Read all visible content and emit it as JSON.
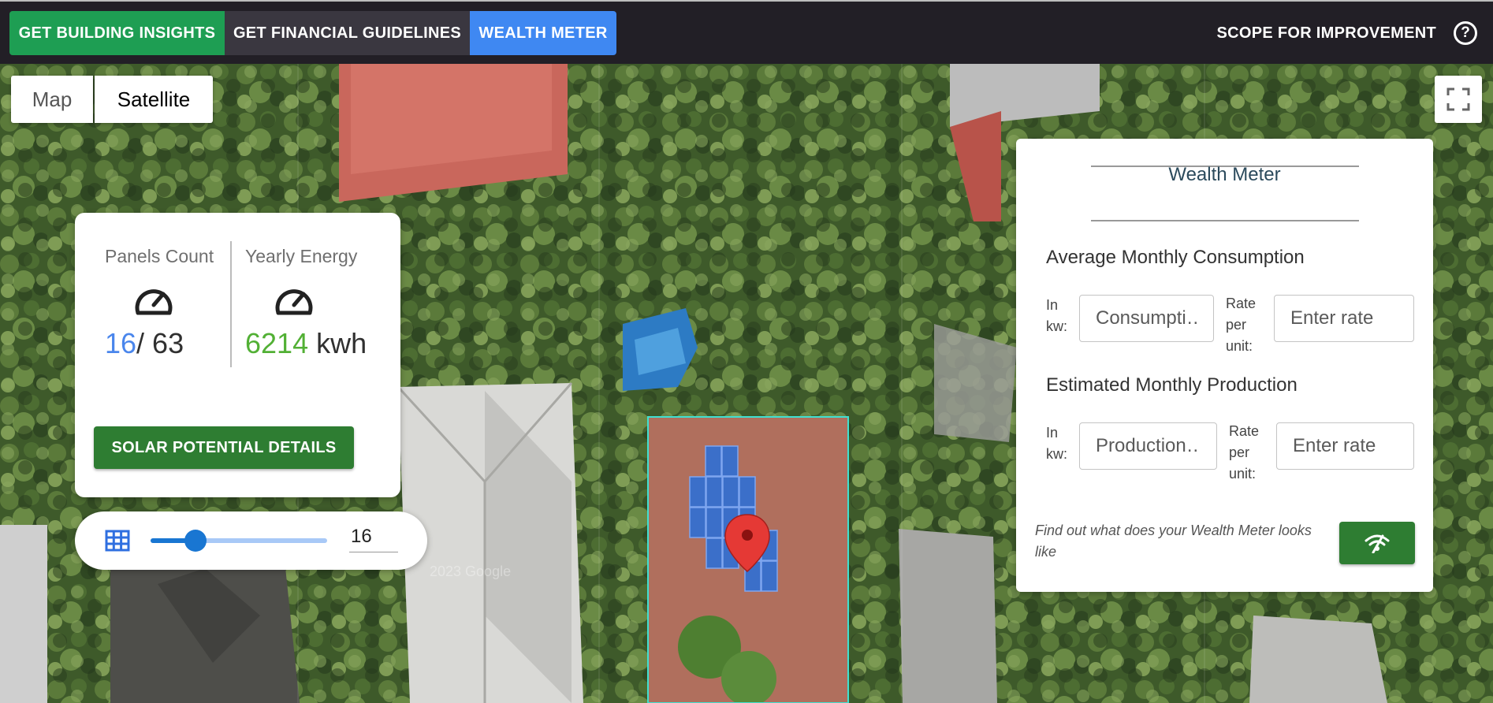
{
  "header": {
    "tabs": [
      {
        "label": "GET BUILDING INSIGHTS",
        "color": "#1e9e53"
      },
      {
        "label": "GET FINANCIAL GUIDELINES",
        "color": "#3a3740"
      },
      {
        "label": "WEALTH METER",
        "color": "#3f88f2",
        "active": true
      }
    ],
    "scope_label": "SCOPE FOR IMPROVEMENT",
    "help_icon": "?"
  },
  "map": {
    "type_buttons": {
      "map": "Map",
      "satellite": "Satellite"
    },
    "selected_type": "Satellite",
    "fullscreen_icon": "fullscreen-icon",
    "watermark": "2023 Google"
  },
  "stats": {
    "panels": {
      "label": "Panels Count",
      "current": "16",
      "total": "/ 63"
    },
    "energy": {
      "label": "Yearly Energy",
      "value": "6214",
      "unit": " kwh"
    },
    "button": "SOLAR POTENTIAL DETAILS"
  },
  "slider": {
    "value": "16",
    "min": 0,
    "max": 63,
    "icon": "grid-icon"
  },
  "wealth": {
    "title": "Wealth Meter",
    "consumption": {
      "heading": "Average Monthly Consumption",
      "in_kw_label_1": "In",
      "in_kw_label_2": "kw:",
      "placeholder": "Consumpti…",
      "rate_label_1": "Rate",
      "rate_label_2": "per",
      "rate_label_3": "unit:",
      "rate_placeholder": "Enter rate"
    },
    "production": {
      "heading": "Estimated Monthly Production",
      "in_kw_label_1": "In",
      "in_kw_label_2": "kw:",
      "placeholder": "Production…",
      "rate_label_1": "Rate",
      "rate_label_2": "per",
      "rate_label_3": "unit:",
      "rate_placeholder": "Enter rate"
    },
    "find_text": "Find out what does your Wealth Meter looks like",
    "go_icon": "signal-icon"
  }
}
